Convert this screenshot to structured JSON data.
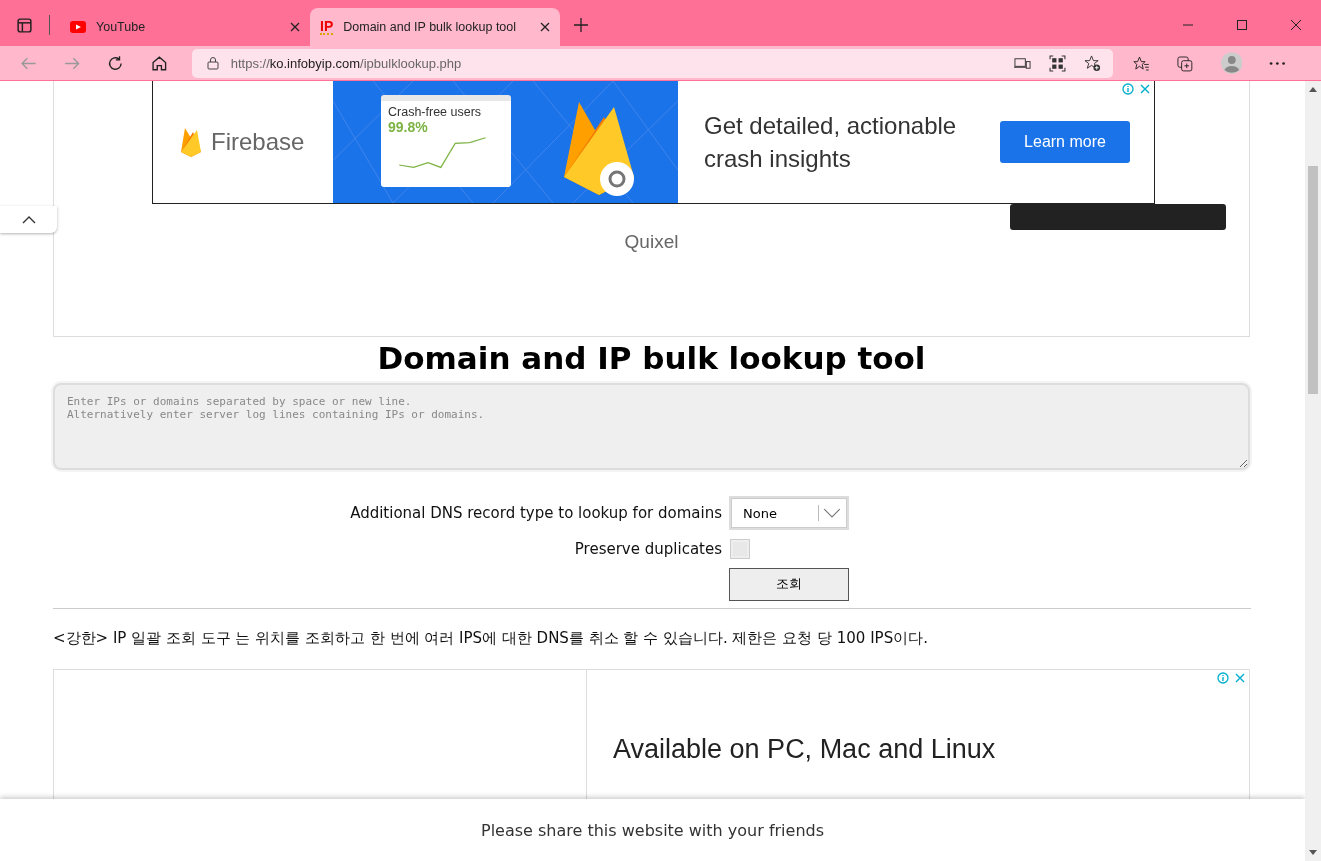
{
  "tabs": [
    {
      "kind": "youtube",
      "title": "YouTube",
      "selected": false
    },
    {
      "kind": "text-icon",
      "icon_text": "IP",
      "title": "Domain and IP bulk lookup tool",
      "selected": true
    }
  ],
  "address": {
    "scheme": "https://",
    "host": "ko.infobyip.com",
    "path": "/ipbulklookup.php"
  },
  "top_ad": {
    "brand": "Firebase",
    "card_title": "Crash-free users",
    "card_value": "99.8%",
    "headline": "Get detailed, actionable crash insights",
    "button": "Learn more"
  },
  "promo": {
    "subtitle": "Quixel"
  },
  "title": "Domain and IP bulk lookup tool",
  "input": {
    "placeholder": "Enter IPs or domains separated by space or new line.\nAlternatively enter server log lines containing IPs or domains."
  },
  "dns": {
    "label": "Additional DNS record type to lookup for domains",
    "value": "None"
  },
  "duplicates": {
    "label": "Preserve duplicates",
    "checked": false
  },
  "submit": "조회",
  "description": "<강한> IP 일괄 조회 도구 는 위치를 조회하고 한 번에 여러 IPS에 대한 DNS를 취소 할 수 있습니다. 제한은 요청 당 100 IPS이다.",
  "bottom_ad": {
    "headline": "Available on PC, Mac and Linux"
  },
  "share_bar": "Please share this website with your friends"
}
